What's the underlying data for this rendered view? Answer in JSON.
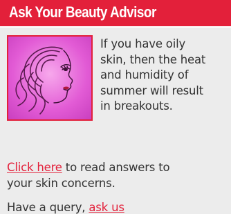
{
  "header": {
    "title": "Ask Your Beauty Advisor"
  },
  "tip": {
    "lines": [
      "If you have oily",
      "skin, then the heat",
      "and humidity of",
      "summer will result",
      "in breakouts."
    ]
  },
  "answers": {
    "link": "Click here",
    "text_rest_line1": " to read answers to",
    "text_line2": "your skin concerns."
  },
  "query": {
    "text": "Have a query, ",
    "link": "ask us"
  },
  "image": {
    "icon": "woman-face-illustration"
  },
  "colors": {
    "header_bg": "#e3203a",
    "panel_bg": "#ececec",
    "link": "#e3203a",
    "text": "#333333",
    "image_bg": "#e25bd5"
  }
}
